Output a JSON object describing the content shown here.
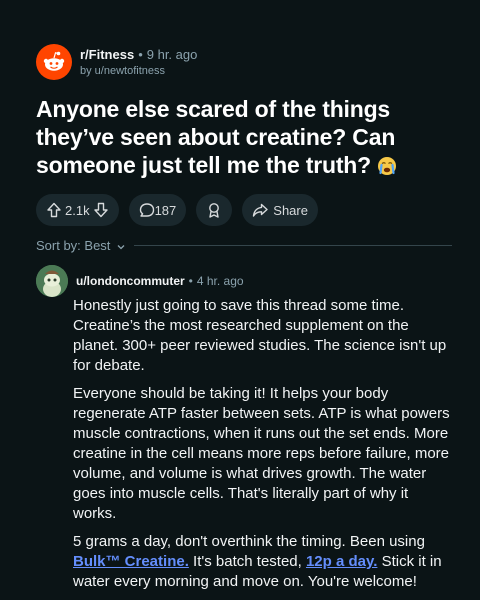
{
  "post": {
    "subreddit": "r/Fitness",
    "separator": "•",
    "time": "9 hr. ago",
    "author": "by u/newtofitness",
    "title": "Anyone else scared of the things they’ve seen about creatine? Can someone just tell me the truth?",
    "title_emoji": "loudly-crying-face"
  },
  "actions": {
    "votes": "2.1k",
    "comments": "187",
    "share_label": "Share"
  },
  "sort": {
    "label": "Sort by: Best"
  },
  "comment": {
    "author": "u/londoncommuter",
    "separator": "•",
    "time": "4 hr. ago",
    "p1": "Honestly just going to save this thread some time. Creatine’s the most researched supplement on the planet. 300+ peer reviewed studies. The science isn't up for debate.",
    "p2": "Everyone should be taking it! It helps your body regenerate ATP faster between sets. ATP is what powers muscle contractions, when it runs out the set ends. More creatine in the cell means more reps before failure, more volume, and volume is what drives growth. The water goes into muscle cells. That's literally part of why it works.",
    "p3_a": "5 grams a day, don't overthink the timing. Been using ",
    "p3_link1": "Bulk™ Creatine.",
    "p3_b": " It's batch tested, ",
    "p3_link2": "12p a day.",
    "p3_c": " Stick it in water every morning and move on. You're welcome!"
  },
  "colors": {
    "background": "#0b1416",
    "accent": "#ff4500",
    "link": "#648efc",
    "pill": "#1a282d",
    "muted": "#8ba2ad"
  }
}
